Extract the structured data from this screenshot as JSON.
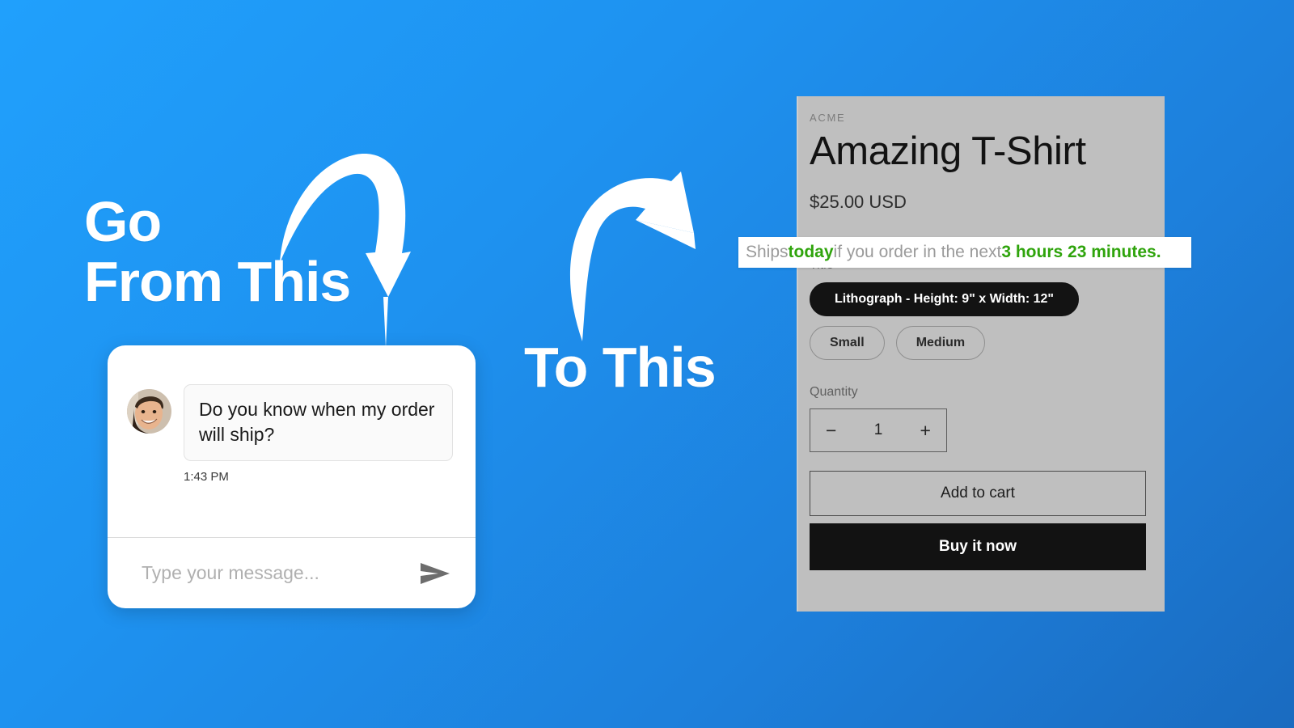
{
  "background": {
    "color_top_left": "#20A0FC",
    "color_bottom_right": "#1A6BC0"
  },
  "headline": {
    "from_line1": "Go",
    "from_line2": "From This",
    "to": "To This"
  },
  "arrows": {
    "down_arrow_name": "curved-arrow-down-icon",
    "up_arrow_name": "curved-arrow-up-right-icon"
  },
  "chat": {
    "message": "Do you know when my order will ship?",
    "timestamp": "1:43 PM",
    "input_placeholder": "Type your message...",
    "input_value": "",
    "send_icon": "send-paper-plane-icon",
    "avatar_icon": "user-avatar"
  },
  "product": {
    "vendor": "ACME",
    "title": "Amazing T-Shirt",
    "price": "$25.00 USD",
    "option_label": "Title",
    "variants": [
      {
        "label": "Lithograph - Height: 9\" x Width: 12\"",
        "selected": true
      },
      {
        "label": "Small",
        "selected": false
      },
      {
        "label": "Medium",
        "selected": false
      }
    ],
    "quantity_label": "Quantity",
    "quantity_decrement": "−",
    "quantity_value": "1",
    "quantity_increment": "+",
    "add_to_cart_label": "Add to cart",
    "buy_now_label": "Buy it now",
    "card_color": "#bfbfbf"
  },
  "shipping_banner": {
    "part1": "Ships ",
    "highlight1": "today",
    "part2": " if you order in the next ",
    "highlight2": "3 hours 23 minutes.",
    "highlight_color": "#2FA40C"
  }
}
